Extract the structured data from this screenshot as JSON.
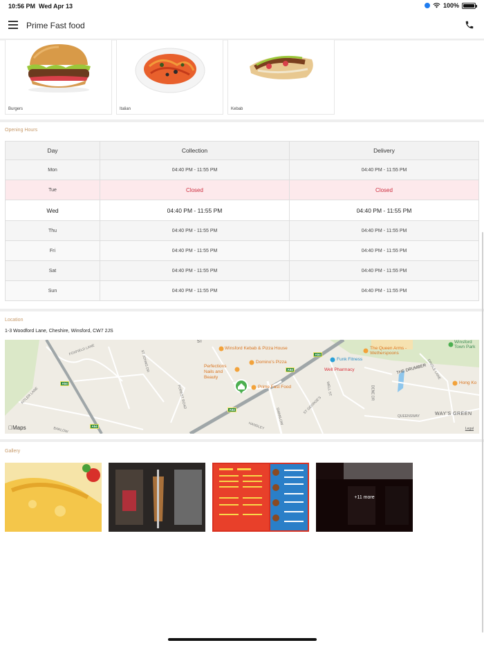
{
  "status_bar": {
    "time": "10:56 PM",
    "date": "Wed Apr 13",
    "battery": "100%"
  },
  "header": {
    "title": "Prime Fast food"
  },
  "categories": [
    {
      "label": "Burgers"
    },
    {
      "label": "Italian"
    },
    {
      "label": "Kebab"
    }
  ],
  "opening_hours": {
    "section_label": "Opening Hours",
    "columns": [
      "Day",
      "Collection",
      "Delivery"
    ],
    "rows": [
      {
        "day": "Mon",
        "collection": "04:40 PM - 11:55 PM",
        "delivery": "04:40 PM - 11:55 PM"
      },
      {
        "day": "Tue",
        "collection": "Closed",
        "delivery": "Closed"
      },
      {
        "day": "Wed",
        "collection": "04:40 PM - 11:55 PM",
        "delivery": "04:40 PM - 11:55 PM"
      },
      {
        "day": "Thu",
        "collection": "04:40 PM - 11:55 PM",
        "delivery": "04:40 PM - 11:55 PM"
      },
      {
        "day": "Fri",
        "collection": "04:40 PM - 11:55 PM",
        "delivery": "04:40 PM - 11:55 PM"
      },
      {
        "day": "Sat",
        "collection": "04:40 PM - 11:55 PM",
        "delivery": "04:40 PM - 11:55 PM"
      },
      {
        "day": "Sun",
        "collection": "04:40 PM - 11:55 PM",
        "delivery": "04:40 PM - 11:55 PM"
      }
    ]
  },
  "location": {
    "section_label": "Location",
    "address": "1-3 Woodford Lane, Cheshire, Winsford, CW7 2JS",
    "map": {
      "places": {
        "winsford_kebab": "Winsford Kebab & Pizza House",
        "dominos": "Domino's Pizza",
        "perfections": "Perfections Nails and Beauty",
        "prime": "Prime Fast Food",
        "queen_arms": "The Queen Arms - Wetherspoons",
        "funk": "Funk Fitness",
        "well_pharmacy": "Well Pharmacy",
        "town_park": "Winsford Town Park",
        "hong_ko": "Hong Ko"
      },
      "roads": {
        "foxfield": "FOXFIELD LANE",
        "st_johns": "ST JOHNS DR",
        "kitler": "KITLER LANE",
        "forest": "FOREST ROAD",
        "handley": "HANDLEY",
        "swanlow": "SWANLOW",
        "barlow": "BARLOW",
        "well_st": "WELL ST",
        "st_georges": "ST GEORGE'S",
        "the_drumber": "THE DRUMBER",
        "dene": "DENE DR",
        "dingle": "DINGLE LANE",
        "queensway": "QUEENSWAY",
        "st": "ST",
        "ways_green": "WAY'S GREEN",
        "a54": "A54"
      },
      "maps_logo": "Maps",
      "legal": "Legal"
    }
  },
  "gallery": {
    "section_label": "Gallery",
    "more_label": "+11 more"
  }
}
